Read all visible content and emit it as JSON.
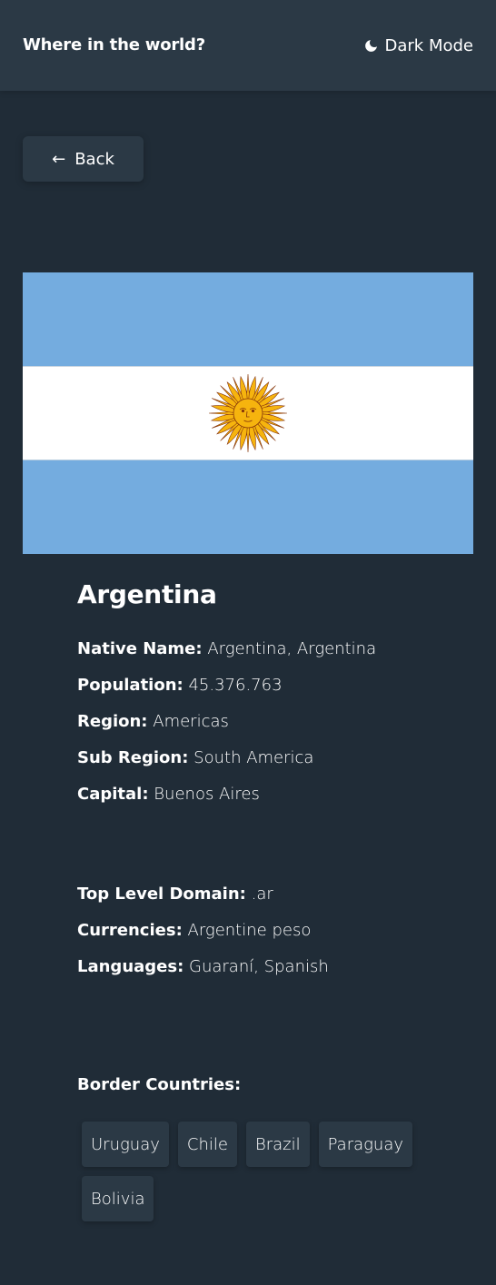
{
  "header": {
    "title": "Where in the world?",
    "mode_label": "Dark Mode",
    "mode_icon": "moon-icon"
  },
  "back_button": {
    "label": "Back",
    "icon": "arrow-left-icon"
  },
  "flag": {
    "country": "Argentina",
    "colors": {
      "light_blue": "#74acdf",
      "white": "#ffffff",
      "sun": "#f6b40e",
      "sun_outline": "#85340a"
    }
  },
  "country": {
    "name": "Argentina",
    "native_name_label": "Native Name:",
    "native_name": "Argentina, Argentina",
    "population_label": "Population:",
    "population": "45.376.763",
    "region_label": "Region:",
    "region": "Americas",
    "sub_region_label": "Sub Region:",
    "sub_region": "South America",
    "capital_label": "Capital:",
    "capital": "Buenos Aires",
    "tld_label": "Top Level Domain:",
    "tld": ".ar",
    "currencies_label": "Currencies:",
    "currencies": "Argentine peso",
    "languages_label": "Languages:",
    "languages": "Guaraní, Spanish"
  },
  "borders": {
    "title": "Border Countries:",
    "countries": [
      "Uruguay",
      "Chile",
      "Brazil",
      "Paraguay",
      "Bolivia"
    ]
  },
  "theme": {
    "background": "#202c37",
    "elements": "#2b3945",
    "text": "#ffffff"
  }
}
